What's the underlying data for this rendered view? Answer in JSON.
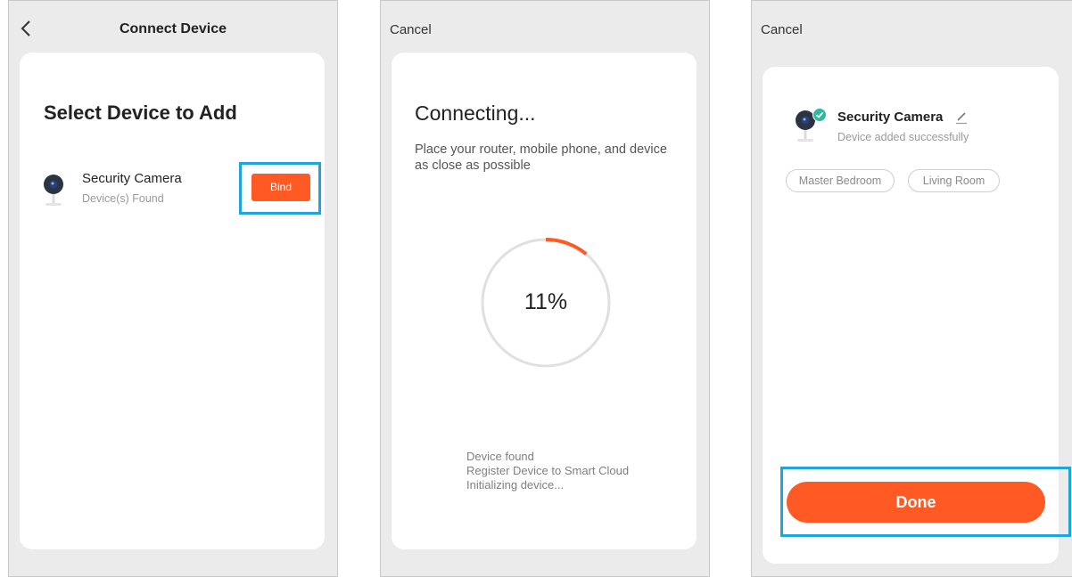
{
  "panel1": {
    "header_title": "Connect Device",
    "heading": "Select Device to Add",
    "device": {
      "name": "Security Camera",
      "status": "Device(s) Found"
    },
    "bind_label": "Bind"
  },
  "panel2": {
    "cancel_label": "Cancel",
    "heading": "Connecting...",
    "description": "Place your router, mobile phone, and device as close as possible",
    "progress_text": "11%",
    "progress_value": 0.11,
    "steps": [
      "Device found",
      "Register Device to Smart Cloud",
      "Initializing device..."
    ]
  },
  "panel3": {
    "cancel_label": "Cancel",
    "device": {
      "name": "Security Camera",
      "status": "Device added successfully"
    },
    "rooms": [
      "Master Bedroom",
      "Living Room"
    ],
    "done_label": "Done"
  },
  "colors": {
    "accent": "#ff5a23",
    "highlight": "#1ea6dc",
    "success": "#2fb9a0"
  },
  "icons": [
    "back-chevron-icon",
    "camera-icon",
    "check-badge-icon",
    "pencil-icon"
  ]
}
